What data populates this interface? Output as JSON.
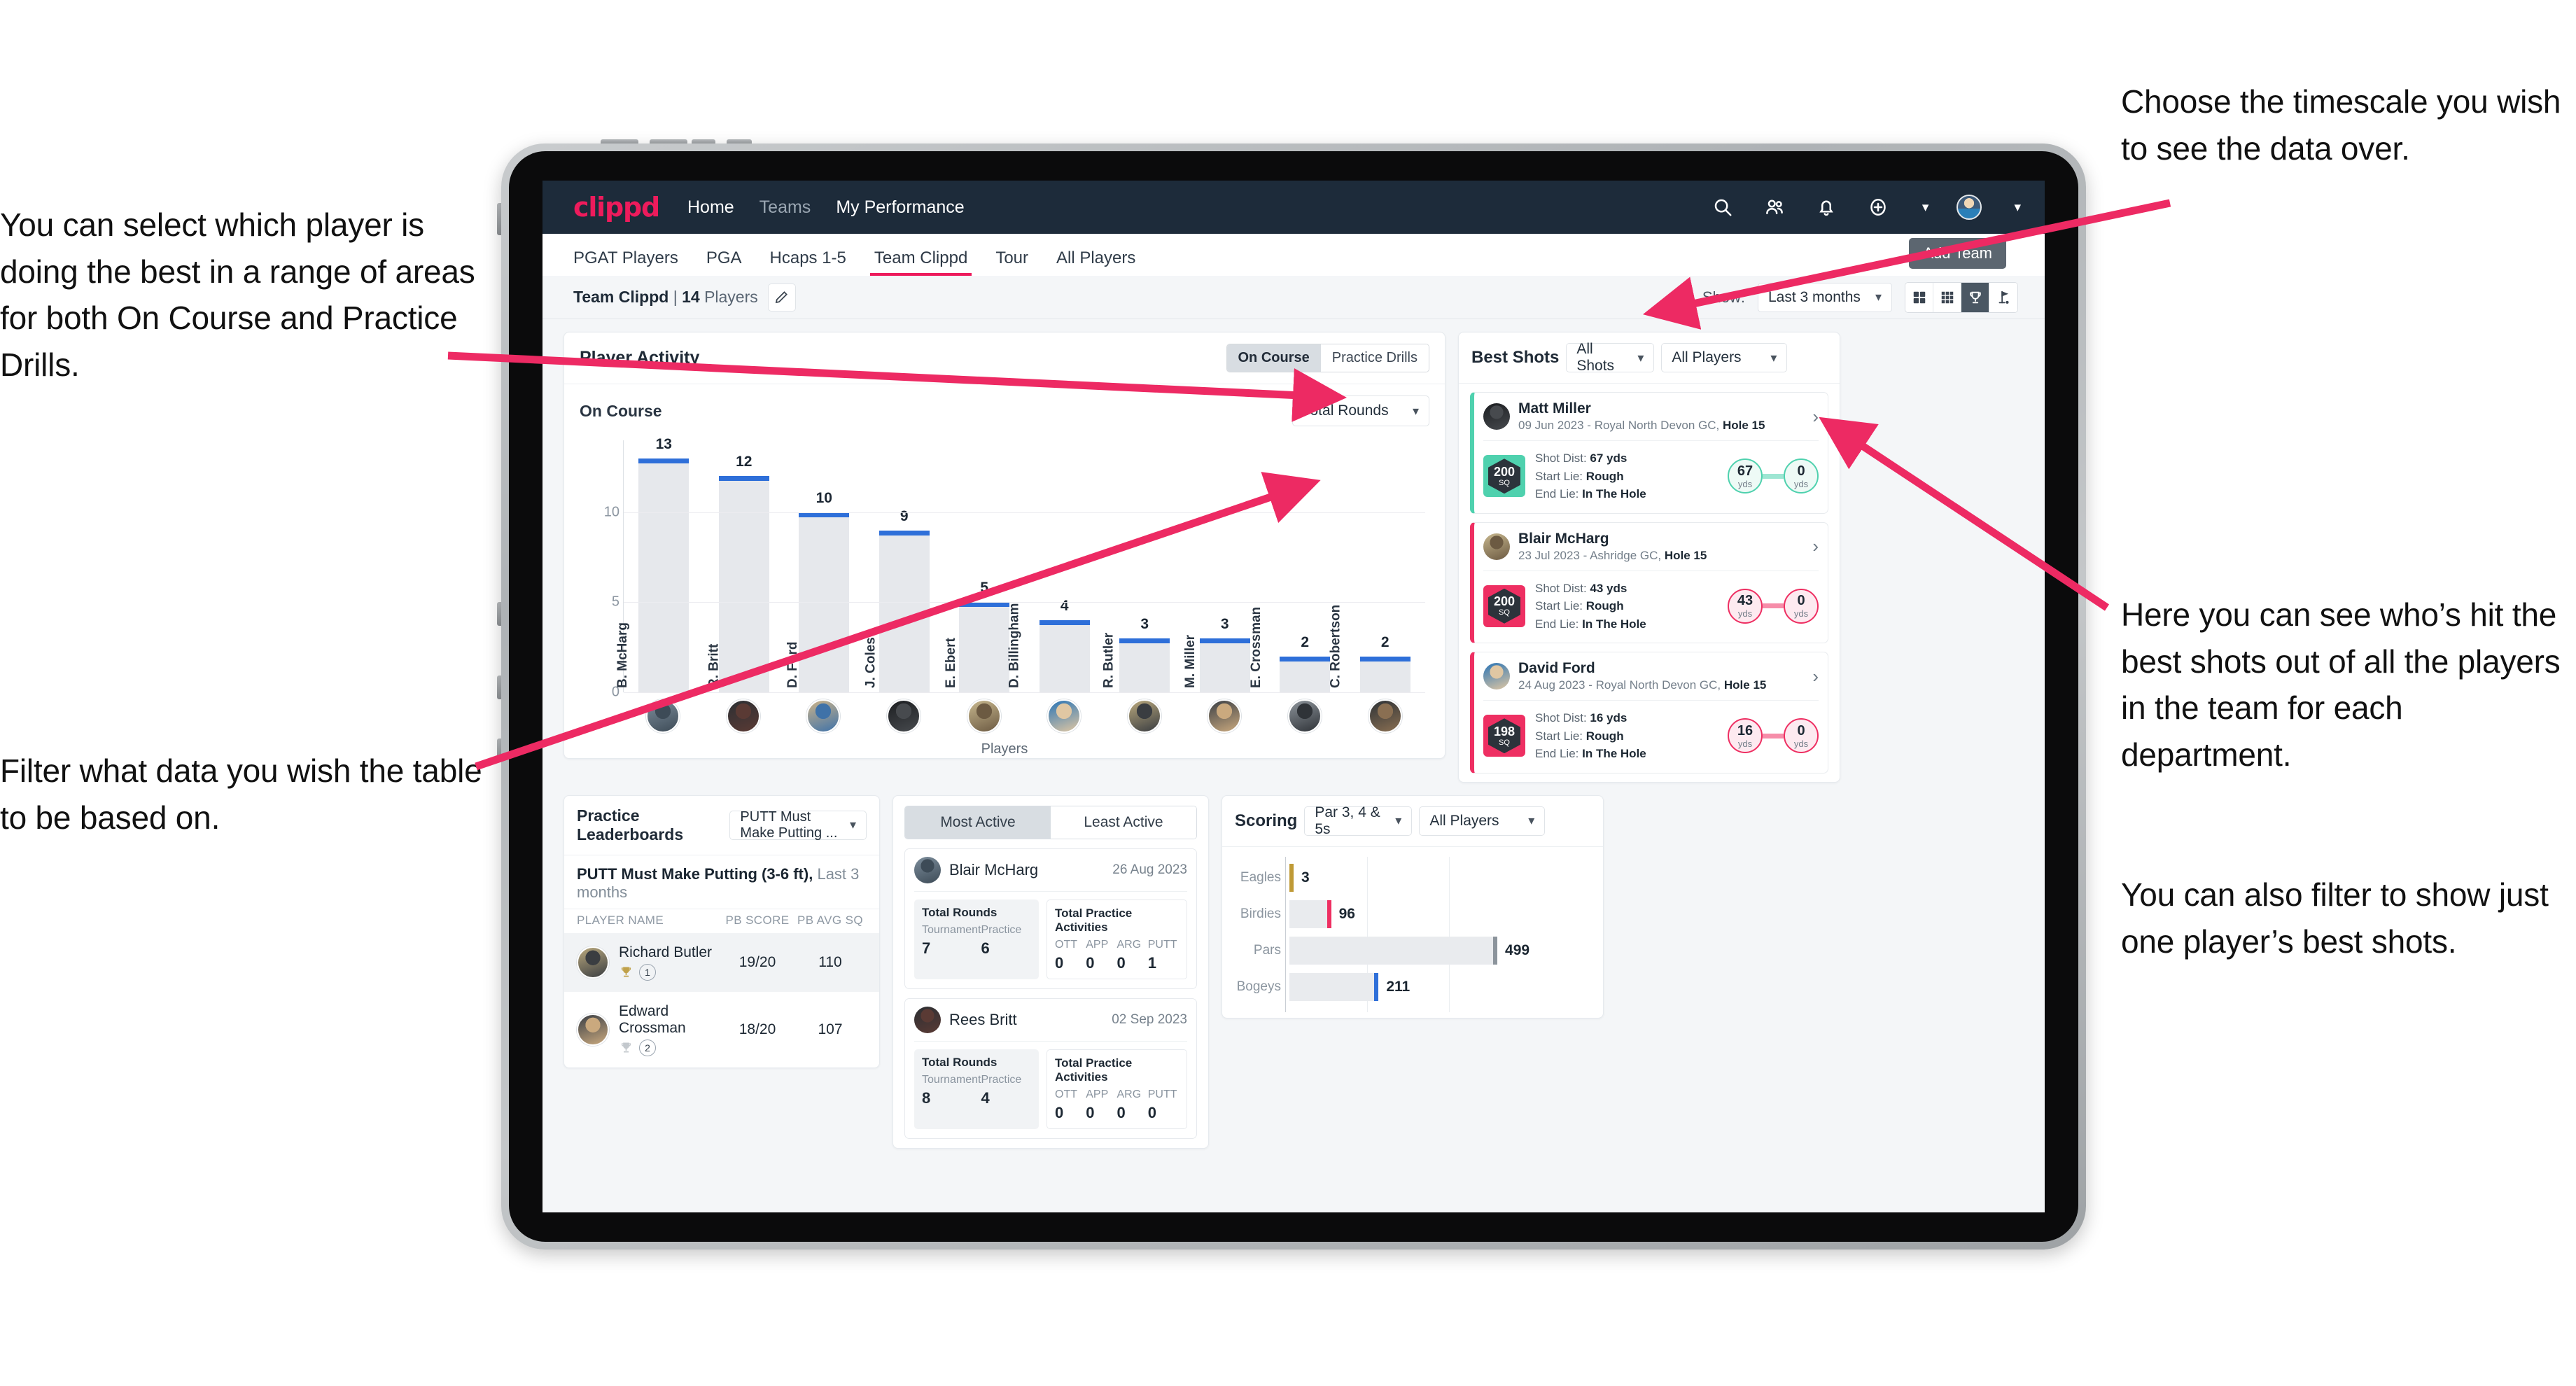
{
  "annotations": {
    "left_top": "You can select which player is doing the best in a range of areas for both On Course and Practice Drills.",
    "left_bottom": "Filter what data you wish the table to be based on.",
    "right_top": "Choose the timescale you wish to see the data over.",
    "right_middle": "Here you can see who’s hit the best shots out of all the players in the team for each department.",
    "right_bottom": "You can also filter to show just one player’s best shots."
  },
  "topnav": {
    "logo": "clippd",
    "links": [
      {
        "label": "Home",
        "dim": false
      },
      {
        "label": "Teams",
        "dim": true
      },
      {
        "label": "My Performance",
        "dim": false
      }
    ],
    "icons": [
      "search-icon",
      "people-icon",
      "bell-icon",
      "plus-circle-icon",
      "avatar"
    ],
    "brand_color": "#ed1b5c",
    "bar_color": "#1d2b3a"
  },
  "subnav": {
    "tabs": [
      {
        "label": "PGAT Players",
        "active": false
      },
      {
        "label": "PGA",
        "active": false
      },
      {
        "label": "Hcaps 1-5",
        "active": false
      },
      {
        "label": "Team Clippd",
        "active": true
      },
      {
        "label": "Tour",
        "active": false
      },
      {
        "label": "All Players",
        "active": false
      }
    ],
    "tooltip": "Add Team"
  },
  "toolbar": {
    "team_name": "Team Clippd",
    "team_count": "14",
    "team_suffix": "Players",
    "edit_icon": "pencil-icon",
    "show_label": "Show:",
    "timescale_value": "Last 3 months",
    "view_buttons": [
      {
        "icon": "grid-2x2-icon",
        "active": false
      },
      {
        "icon": "grid-3x3-icon",
        "active": false
      },
      {
        "icon": "trophy-icon",
        "active": true
      },
      {
        "icon": "flag-pin-icon",
        "active": false
      }
    ]
  },
  "player_activity": {
    "title": "Player Activity",
    "segments": [
      {
        "label": "On Course",
        "active": true
      },
      {
        "label": "Practice Drills",
        "active": false
      }
    ],
    "subtitle": "On Course",
    "metric_dropdown": "Total Rounds",
    "chart_data": {
      "type": "bar",
      "title": "Player Activity — On Course",
      "categories": [
        "B. McHarg",
        "R. Britt",
        "D. Ford",
        "J. Coles",
        "E. Ebert",
        "D. Billingham",
        "R. Butler",
        "M. Miller",
        "E. Crossman",
        "C. Robertson"
      ],
      "values": [
        13,
        12,
        10,
        9,
        5,
        4,
        3,
        3,
        2,
        2
      ],
      "xlabel": "Players",
      "ylabel": "Total Rounds",
      "yticks": [
        0,
        5,
        10
      ],
      "ylim": [
        0,
        14
      ],
      "bar_color": "#e6e8ec",
      "cap_color": "#2e6fd9",
      "grid": true
    }
  },
  "best_shots": {
    "title": "Best Shots",
    "filter_shots": "All Shots",
    "filter_players": "All Players",
    "cards": [
      {
        "name": "Matt Miller",
        "meta_date": "09 Jun 2023",
        "meta_course": "Royal North Devon GC,",
        "meta_hole": "Hole 15",
        "sq_value": "200",
        "sq_unit": "SQ",
        "accent": "#4fd1ae",
        "shot_dist_label": "Shot Dist:",
        "shot_dist_value": "67 yds",
        "start_lie_label": "Start Lie:",
        "start_lie_value": "Rough",
        "end_lie_label": "End Lie:",
        "end_lie_value": "In The Hole",
        "from_value": "67",
        "from_unit": "yds",
        "to_value": "0",
        "to_unit": "yds"
      },
      {
        "name": "Blair McHarg",
        "meta_date": "23 Jul 2023",
        "meta_course": "Ashridge GC,",
        "meta_hole": "Hole 15",
        "sq_value": "200",
        "sq_unit": "SQ",
        "accent": "#ee2f62",
        "shot_dist_label": "Shot Dist:",
        "shot_dist_value": "43 yds",
        "start_lie_label": "Start Lie:",
        "start_lie_value": "Rough",
        "end_lie_label": "End Lie:",
        "end_lie_value": "In The Hole",
        "from_value": "43",
        "from_unit": "yds",
        "to_value": "0",
        "to_unit": "yds"
      },
      {
        "name": "David Ford",
        "meta_date": "24 Aug 2023",
        "meta_course": "Royal North Devon GC,",
        "meta_hole": "Hole 15",
        "sq_value": "198",
        "sq_unit": "SQ",
        "accent": "#ee2f62",
        "shot_dist_label": "Shot Dist:",
        "shot_dist_value": "16 yds",
        "start_lie_label": "Start Lie:",
        "start_lie_value": "Rough",
        "end_lie_label": "End Lie:",
        "end_lie_value": "In The Hole",
        "from_value": "16",
        "from_unit": "yds",
        "to_value": "0",
        "to_unit": "yds"
      }
    ]
  },
  "practice_leaderboards": {
    "title": "Practice Leaderboards",
    "drill_dropdown": "PUTT Must Make Putting ...",
    "sub_title": "PUTT Must Make Putting (3-6 ft),",
    "sub_period": "Last 3 months",
    "columns": [
      "PLAYER NAME",
      "PB SCORE",
      "PB AVG SQ"
    ],
    "rows": [
      {
        "name": "Richard Butler",
        "rank": "1",
        "trophy": "gold",
        "pb_score": "19/20",
        "pb_avg_sq": "110",
        "highlight": true
      },
      {
        "name": "Edward Crossman",
        "rank": "2",
        "trophy": "silver",
        "pb_score": "18/20",
        "pb_avg_sq": "107",
        "highlight": false
      }
    ]
  },
  "activity": {
    "tabs": [
      {
        "label": "Most Active",
        "active": true
      },
      {
        "label": "Least Active",
        "active": false
      }
    ],
    "cards": [
      {
        "name": "Blair McHarg",
        "date": "26 Aug 2023",
        "rounds_title": "Total Rounds",
        "rounds": [
          {
            "key": "Tournament",
            "value": "7"
          },
          {
            "key": "Practice",
            "value": "6"
          }
        ],
        "practice_title": "Total Practice Activities",
        "practice": [
          {
            "key": "OTT",
            "value": "0"
          },
          {
            "key": "APP",
            "value": "0"
          },
          {
            "key": "ARG",
            "value": "0"
          },
          {
            "key": "PUTT",
            "value": "1"
          }
        ]
      },
      {
        "name": "Rees Britt",
        "date": "02 Sep 2023",
        "rounds_title": "Total Rounds",
        "rounds": [
          {
            "key": "Tournament",
            "value": "8"
          },
          {
            "key": "Practice",
            "value": "4"
          }
        ],
        "practice_title": "Total Practice Activities",
        "practice": [
          {
            "key": "OTT",
            "value": "0"
          },
          {
            "key": "APP",
            "value": "0"
          },
          {
            "key": "ARG",
            "value": "0"
          },
          {
            "key": "PUTT",
            "value": "0"
          }
        ]
      }
    ]
  },
  "scoring": {
    "title": "Scoring",
    "filter_par": "Par 3, 4 & 5s",
    "filter_players": "All Players",
    "chart_data": {
      "type": "bar",
      "orientation": "horizontal",
      "title": "Scoring",
      "categories": [
        "Eagles",
        "Birdies",
        "Pars",
        "Bogeys"
      ],
      "values": [
        3,
        96,
        499,
        211
      ],
      "colors": [
        "#bf9a36",
        "#ee2f62",
        "#8c949c",
        "#2e6fd9"
      ],
      "xlim": [
        0,
        560
      ],
      "grid": true,
      "track_color": "#e9ebee"
    }
  }
}
